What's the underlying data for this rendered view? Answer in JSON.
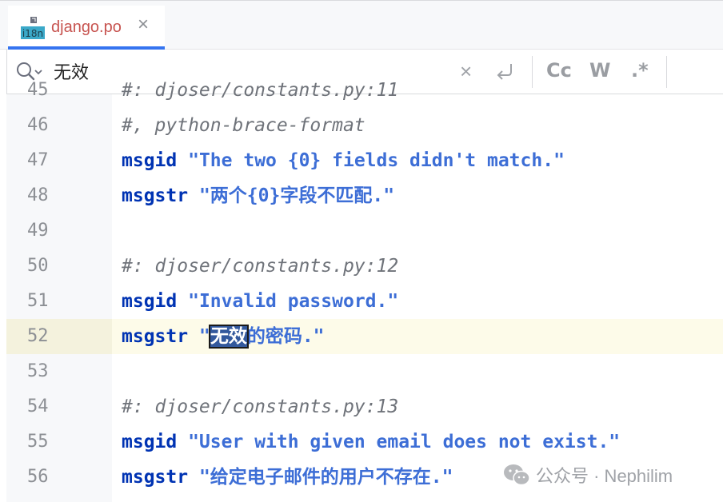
{
  "tab": {
    "icon_label": "i18n",
    "title": "django.po",
    "close": "×"
  },
  "search": {
    "value": "无效",
    "clear": "×",
    "opt_case": "Cc",
    "opt_word": "W",
    "opt_regex": ".*"
  },
  "editor": {
    "partial_top": {
      "number": "45",
      "text": "#: djoser/constants.py:11"
    },
    "lines": [
      {
        "number": "46",
        "parts": [
          {
            "cls": "comment",
            "text": "#, python-brace-format"
          }
        ]
      },
      {
        "number": "47",
        "parts": [
          {
            "cls": "kw",
            "text": "msgid"
          },
          {
            "cls": "",
            "text": " "
          },
          {
            "cls": "str",
            "text": "\"The two {0} fields didn't match.\""
          }
        ]
      },
      {
        "number": "48",
        "parts": [
          {
            "cls": "kw",
            "text": "msgstr"
          },
          {
            "cls": "",
            "text": " "
          },
          {
            "cls": "str",
            "text": "\"两个{0}字段不匹配.\""
          }
        ]
      },
      {
        "number": "49",
        "parts": []
      },
      {
        "number": "50",
        "parts": [
          {
            "cls": "comment",
            "text": "#: djoser/constants.py:12"
          }
        ]
      },
      {
        "number": "51",
        "parts": [
          {
            "cls": "kw",
            "text": "msgid"
          },
          {
            "cls": "",
            "text": " "
          },
          {
            "cls": "str",
            "text": "\"Invalid password.\""
          }
        ]
      },
      {
        "number": "52",
        "current": true,
        "parts": [
          {
            "cls": "kw",
            "text": "msgstr"
          },
          {
            "cls": "",
            "text": " "
          },
          {
            "cls": "str",
            "text": "\""
          },
          {
            "cls": "str match",
            "text": "无效"
          },
          {
            "cls": "str",
            "text": "的密码.\""
          }
        ]
      },
      {
        "number": "53",
        "parts": []
      },
      {
        "number": "54",
        "parts": [
          {
            "cls": "comment",
            "text": "#: djoser/constants.py:13"
          }
        ]
      },
      {
        "number": "55",
        "parts": [
          {
            "cls": "kw",
            "text": "msgid"
          },
          {
            "cls": "",
            "text": " "
          },
          {
            "cls": "str",
            "text": "\"User with given email does not exist.\""
          }
        ]
      },
      {
        "number": "56",
        "parts": [
          {
            "cls": "kw",
            "text": "msgstr"
          },
          {
            "cls": "",
            "text": " "
          },
          {
            "cls": "str",
            "text": "\"给定电子邮件的用户不存在.\""
          }
        ]
      }
    ]
  },
  "watermark": {
    "text": "公众号 · Nephilim"
  },
  "colors": {
    "accent": "#3574f0",
    "match_bg": "#33599d",
    "keyword": "#0033b3",
    "string": "#3d6ed6",
    "comment": "#6f737a"
  }
}
